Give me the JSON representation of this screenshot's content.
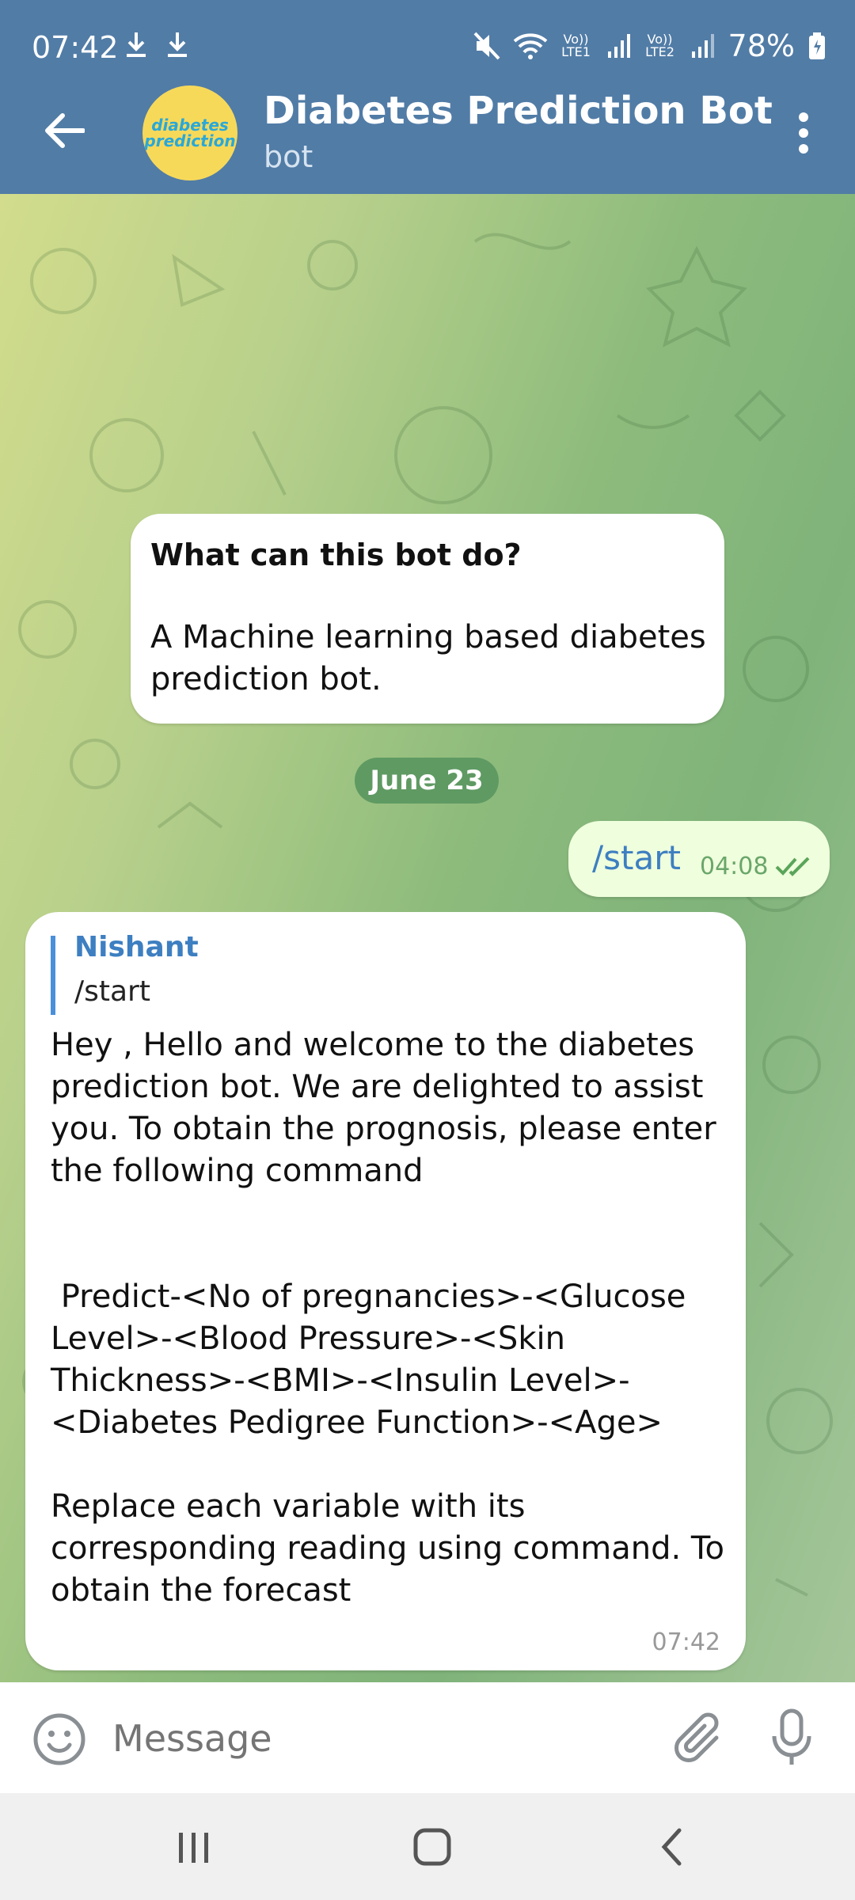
{
  "status": {
    "time": "07:42",
    "lte1": "Vo)) LTE1",
    "lte2": "Vo)) LTE2",
    "battery": "78%"
  },
  "header": {
    "title": "Diabetes Prediction Bot",
    "subtitle": "bot",
    "avatar_text": "diabetes prediction"
  },
  "chat": {
    "info": {
      "title": "What can this bot do?",
      "text": "A Machine learning based diabetes prediction bot."
    },
    "date": "June 23",
    "outgoing": {
      "text": "/start",
      "time": "04:08"
    },
    "incoming": {
      "reply_name": "Nishant",
      "reply_text": "/start",
      "text": "Hey , Hello and welcome to the diabetes prediction bot. We are delighted to assist you. To obtain the prognosis, please enter the following command\n\n\n Predict-<No of pregnancies>-<Glucose Level>-<Blood Pressure>-<Skin Thickness>-<BMI>-<Insulin Level>-<Diabetes Pedigree Function>-<Age>\n\nReplace each variable with its corresponding reading using command. To obtain the forecast",
      "time": "07:42"
    }
  },
  "input": {
    "placeholder": "Message"
  },
  "colors": {
    "header": "#517ca6",
    "outgoing_bubble": "#effedd",
    "link": "#3d7fc1",
    "date_pill": "#5f9a63"
  },
  "icons": {
    "back": "arrow-left-icon",
    "menu": "more-vertical-icon",
    "emoji": "smile-icon",
    "attach": "paperclip-icon",
    "mic": "microphone-icon",
    "double_check": "double-check-icon"
  }
}
